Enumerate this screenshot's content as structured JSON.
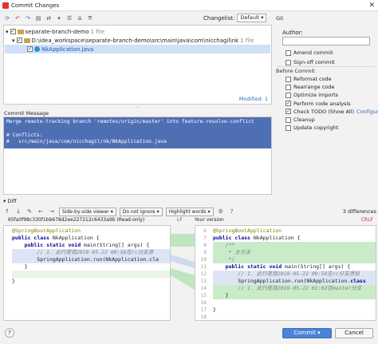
{
  "window": {
    "title": "Commit Changes",
    "close_glyph": "✕"
  },
  "toolbar": {
    "icons": [
      "refresh-icon",
      "undo-icon",
      "redo-icon",
      "diff-icon",
      "move-icon",
      "more-icon",
      "group-icon",
      "expand-icon",
      "collapse-icon"
    ]
  },
  "changelist": {
    "label": "Changelist:",
    "value": "Default"
  },
  "tree": {
    "root": {
      "label": "separate-branch-demo",
      "count": "1 file"
    },
    "path": {
      "label": "D:\\idea_workspace\\separate-branch-demo\\src\\main\\java\\com\\nicchagil\\nk",
      "count": "1 file"
    },
    "file": {
      "label": "NkApplication.java"
    },
    "modified": "Modified: 1"
  },
  "commit_message": {
    "label": "Commit Message",
    "lines": [
      "Merge remote-tracking branch 'remotes/origin/master' into feature-resolve-conflict",
      "",
      "# Conflicts:",
      "#   src/main/java/com/nicchagil/nk/NkApplication.java"
    ]
  },
  "git": {
    "section": "Git",
    "author_label": "Author:",
    "author_value": "",
    "amend": {
      "label": "Amend commit",
      "checked": false
    },
    "signoff": {
      "label": "Sign-off commit",
      "checked": false
    }
  },
  "before_commit": {
    "section": "Before Commit",
    "options": [
      {
        "label": "Reformat code",
        "checked": false
      },
      {
        "label": "Rearrange code",
        "checked": false
      },
      {
        "label": "Optimize imports",
        "checked": false
      },
      {
        "label": "Perform code analysis",
        "checked": true
      },
      {
        "label": "Check TODO (Show All)",
        "checked": true,
        "link": "Configure"
      },
      {
        "label": "Cleanup",
        "checked": false
      },
      {
        "label": "Update copyright",
        "checked": false
      }
    ]
  },
  "diff": {
    "label": "Diff",
    "viewer": "Side-by-side viewer",
    "ignore": "Do not ignore",
    "highlight": "Highlight words",
    "differences": "3 differences",
    "left_header": "65fa0f98c330f1bb678d2ee227212c6433a9b (Read-only)",
    "left_lf": "LF",
    "right_header": "Your version",
    "right_crlf": "CRLF",
    "left_lines": [
      {
        "t": "@SpringBootApplication",
        "k": "ann"
      },
      {
        "t": "public class NkApplication {",
        "k": "code"
      },
      {
        "t": "    public static void main(String[] args) {",
        "k": "code"
      },
      {
        "t": "        // 1. 此行是我2019-05-22 00:58在rc分支添",
        "k": "cmt"
      },
      {
        "t": "        SpringApplication.run(NkApplication.cla",
        "k": "code"
      },
      {
        "t": "    }",
        "k": "code"
      },
      {
        "t": "",
        "k": "code"
      },
      {
        "t": "}",
        "k": "code"
      }
    ],
    "right_numbers": [
      "6",
      "7",
      "8",
      "9",
      "10",
      "11",
      "12",
      "13",
      "14",
      "15",
      "16",
      "17",
      "18"
    ],
    "right_lines": [
      {
        "t": "@SpringBootApplication",
        "k": "ann"
      },
      {
        "t": "public class NkApplication {",
        "k": "code"
      },
      {
        "t": "    /**",
        "k": "cmt"
      },
      {
        "t": "     * 主方法",
        "k": "cmt"
      },
      {
        "t": "     */",
        "k": "cmt"
      },
      {
        "t": "    public static void main(String[] args) {",
        "k": "code"
      },
      {
        "t": "        // 1. 此行是我2019-05-22 00:58在rc分支添加",
        "k": "cmt"
      },
      {
        "t": "        SpringApplication.run(NkApplication.class",
        "k": "code"
      },
      {
        "t": "        // 1. 此行是我2019-05-22 01:02在master分支",
        "k": "cmt"
      },
      {
        "t": "    }",
        "k": "code"
      },
      {
        "t": "",
        "k": "code"
      },
      {
        "t": "}",
        "k": "code"
      },
      {
        "t": "",
        "k": "code"
      }
    ]
  },
  "buttons": {
    "commit": "Commit",
    "cancel": "Cancel",
    "help": "?"
  }
}
